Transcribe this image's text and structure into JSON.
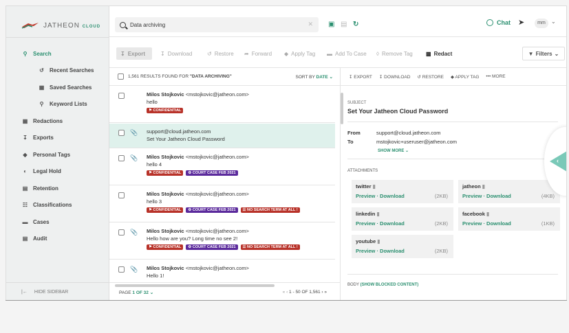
{
  "brand": {
    "name": "JATHEON",
    "suffix": "CLOUD",
    "accent": "#2a8f6f"
  },
  "search": {
    "query": "Data archiving"
  },
  "topbar": {
    "chat_label": "Chat",
    "avatar": "mm"
  },
  "sidebar": {
    "items": [
      {
        "label": "Search",
        "icon": "search-icon",
        "active": true
      },
      {
        "label": "Recent Searches",
        "icon": "history-icon",
        "sub": true
      },
      {
        "label": "Saved Searches",
        "icon": "save-icon",
        "sub": true
      },
      {
        "label": "Keyword Lists",
        "icon": "key-icon",
        "sub": true
      },
      {
        "label": "Redactions",
        "icon": "redact-icon"
      },
      {
        "label": "Exports",
        "icon": "export-icon"
      },
      {
        "label": "Personal Tags",
        "icon": "tag-icon"
      },
      {
        "label": "Legal Hold",
        "icon": "hold-icon"
      },
      {
        "label": "Retention",
        "icon": "retention-icon"
      },
      {
        "label": "Classifications",
        "icon": "classification-icon"
      },
      {
        "label": "Cases",
        "icon": "folder-icon"
      },
      {
        "label": "Audit",
        "icon": "audit-icon"
      }
    ],
    "hide_label": "HIDE SIDEBAR"
  },
  "toolbar": {
    "export": "Export",
    "download": "Download",
    "restore": "Restore",
    "forward": "Forward",
    "apply_tag": "Apply Tag",
    "add_to_case": "Add To Case",
    "remove_tag": "Remove Tag",
    "redact": "Redact",
    "filters": "Filters"
  },
  "results": {
    "count_prefix": "1,561 RESULTS FOUND FOR",
    "query_label": "\"DATA ARCHIVING\"",
    "sort_prefix": "SORT BY",
    "sort_value": "DATE",
    "rows": [
      {
        "name": "Milos Stojkovic",
        "email": "<mstojkovic@jatheon.com>",
        "subject": "hello",
        "attach": false,
        "selected": false,
        "tags": [
          {
            "label": "CONFIDENTIAL",
            "color": "red"
          }
        ]
      },
      {
        "name": "",
        "email": "support@cloud.jatheon.com",
        "subject": "Set Your Jatheon Cloud Password",
        "attach": true,
        "selected": true,
        "tags": []
      },
      {
        "name": "Milos Stojkovic",
        "email": "<mstojkovic@jatheon.com>",
        "subject": "hello 4",
        "attach": true,
        "selected": false,
        "tags": [
          {
            "label": "CONFIDENTIAL",
            "color": "red"
          },
          {
            "label": "COURT CASE FEB 2021",
            "color": "purple"
          }
        ]
      },
      {
        "name": "Milos Stojkovic",
        "email": "<mstojkovic@jatheon.com>",
        "subject": "hello 3",
        "attach": false,
        "selected": false,
        "tags": [
          {
            "label": "CONFIDENTIAL",
            "color": "red"
          },
          {
            "label": "COURT CASE FEB 2021",
            "color": "purple"
          },
          {
            "label": "NO SEARCH TERM AT ALL !",
            "color": "red"
          }
        ]
      },
      {
        "name": "Milos Stojkovic",
        "email": "<mstojkovic@jatheon.com>",
        "subject": "Hello how are you? Long time no see 2!",
        "attach": true,
        "selected": false,
        "tags": [
          {
            "label": "CONFIDENTIAL",
            "color": "red"
          },
          {
            "label": "COURT CASE FEB 2021",
            "color": "purple"
          },
          {
            "label": "NO SEARCH TERM AT ALL !",
            "color": "red"
          }
        ]
      },
      {
        "name": "Milos Stojkovic",
        "email": "<mstojkovic@jatheon.com>",
        "subject": "Hello 1!",
        "attach": true,
        "selected": false,
        "tags": []
      }
    ],
    "pager_prefix": "PAGE",
    "pager_value": "1 OF 32",
    "pager_range": "1 - 50 OF 1,561"
  },
  "detail": {
    "toolbar": {
      "export": "EXPORT",
      "download": "DOWNLOAD",
      "restore": "RESTORE",
      "apply_tag": "APPLY TAG",
      "more": "MORE"
    },
    "subject_label": "SUBJECT",
    "subject": "Set Your Jatheon Cloud Password",
    "from_label": "From",
    "from": "support@cloud.jatheon.com",
    "to_label": "To",
    "to": "mstojkovic+useruser@jatheon.com",
    "show_more": "SHOW MORE",
    "attachments_label": "ATTACHMENTS",
    "attachments": [
      {
        "name": "twitter",
        "size": "(2KB)"
      },
      {
        "name": "jatheon",
        "size": "(4KB)"
      },
      {
        "name": "linkedin",
        "size": "(2KB)"
      },
      {
        "name": "facebook",
        "size": "(1KB)"
      },
      {
        "name": "youtube",
        "size": "(2KB)"
      }
    ],
    "preview": "Preview",
    "download": "Download",
    "body_label": "BODY",
    "show_blocked": "(SHOW BLOCKED CONTENT)"
  }
}
